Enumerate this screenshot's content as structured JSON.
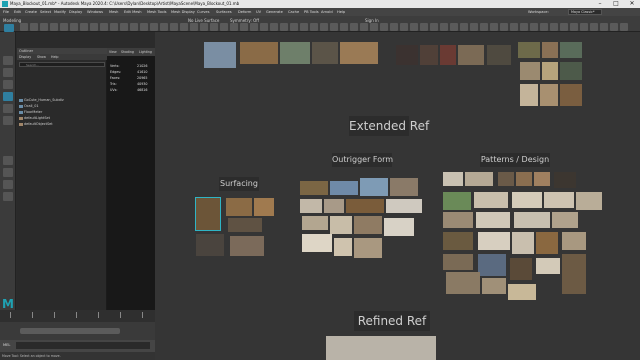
{
  "window": {
    "title": "Maya_Blockout_01.mb* - Autodesk Maya 2020.4: C:\\Users\\Dylan\\Desktop\\Artist\\MayaScene\\Maya_Blockout_01.mb",
    "minimize": "–",
    "maximize": "□",
    "close": "✕"
  },
  "menubar": {
    "items": [
      "File",
      "Edit",
      "Create",
      "Select",
      "Modify",
      "Display",
      "Windows",
      "Mesh",
      "Edit Mesh",
      "Mesh Tools",
      "Mesh Display",
      "Curves",
      "Surfaces",
      "Deform",
      "UV",
      "Generate",
      "Cache",
      "PB Tools",
      "Arnold",
      "Help"
    ],
    "mode_select": "Modeling",
    "live_surface": "No Live Surface",
    "symmetry": "Symmetry: Off",
    "sign_in": "Sign In",
    "workspace_label": "Workspace:",
    "workspace_value": "Maya Classic*"
  },
  "outliner": {
    "title": "Outliner",
    "menu": [
      "Display",
      "Show",
      "Help"
    ],
    "search_placeholder": "Search...",
    "items": [
      "GoCute_Human_Subdiv",
      "Ocall_01",
      "FloorMeter",
      "defaultLightSet",
      "defaultObjectSet"
    ]
  },
  "mini_view": {
    "menu": [
      "View",
      "Shading",
      "Lighting"
    ],
    "stats": [
      {
        "k": "Verts:",
        "v": "21026"
      },
      {
        "k": "Edges:",
        "v": "41610"
      },
      {
        "k": "Faces:",
        "v": "20965"
      },
      {
        "k": "Tris:",
        "v": "40930"
      },
      {
        "k": "UVs:",
        "v": "46816"
      }
    ]
  },
  "canvas": {
    "labels": {
      "extended": "Extended Ref",
      "outrigger": "Outrigger Form",
      "patterns": "Patterns / Design",
      "surfacing": "Surfacing",
      "refined": "Refined Ref"
    }
  },
  "colors": {
    "accent": "#1fa2b3",
    "canvas": "#353535",
    "panel": "#2a2a2a"
  },
  "status": {
    "line": "Move Tool: Select an object to move."
  },
  "timeline_ticks": [
    "1",
    "5",
    "10",
    "15",
    "20",
    "25",
    "30"
  ],
  "command": {
    "lang": "MEL"
  },
  "logo": "M"
}
